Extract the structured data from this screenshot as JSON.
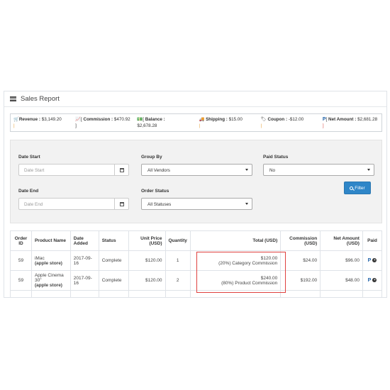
{
  "panel": {
    "title": "Sales Report",
    "title_icon": "list-icon"
  },
  "summary": {
    "revenue": {
      "icon": "cart-icon",
      "label": "Revenue :",
      "value": "$3,149.20",
      "after": "|"
    },
    "commission": {
      "icon": "chart-icon",
      "label": "Commission :",
      "value": "$470.92",
      "after": "]"
    },
    "balance": {
      "icon": "money-icon",
      "label": "Balance :",
      "value": "$2,678.28",
      "after": ""
    },
    "shipping": {
      "icon": "truck-icon",
      "label": "Shipping :",
      "value": "$15.00",
      "after": "|"
    },
    "coupon": {
      "icon": "tag-icon",
      "label": "Coupon :",
      "value": "-$12.00",
      "after": "|"
    },
    "net_amount": {
      "icon": "paypal-icon",
      "label": "Net Amount :",
      "value": "$2,681.28",
      "after": "]"
    }
  },
  "filters": {
    "date_start": {
      "label": "Date Start",
      "placeholder": "Date Start"
    },
    "date_end": {
      "label": "Date End",
      "placeholder": "Date End"
    },
    "group_by": {
      "label": "Group By",
      "value": "All Vendors"
    },
    "order_status": {
      "label": "Order Status",
      "value": "All Statuses"
    },
    "paid_status": {
      "label": "Paid Status",
      "value": "No"
    },
    "filter_button": "Filter"
  },
  "table": {
    "headers": {
      "order_id": "Order ID",
      "product_name": "Product Name",
      "date_added": "Date Added",
      "status": "Status",
      "unit_price": "Unit Price (USD)",
      "quantity": "Quantity",
      "total": "Total (USD)",
      "commission": "Commission (USD)",
      "net_amount": "Net Amount (USD)",
      "paid": "Paid"
    },
    "rows": [
      {
        "order_id": "59",
        "product": "iMac",
        "store": "(apple store)",
        "date": "2017-09-16",
        "status": "Complete",
        "unit_price": "$120.00",
        "quantity": "1",
        "total": "$120.00",
        "total_note": "(20%) Category Commission",
        "commission": "$24.00",
        "net": "$96.00"
      },
      {
        "order_id": "59",
        "product": "Apple Cinema 30\"",
        "store": "(apple store)",
        "date": "2017-09-16",
        "status": "Complete",
        "unit_price": "$120.00",
        "quantity": "2",
        "total": "$240.00",
        "total_note": "(80%) Product Commission",
        "commission": "$192.00",
        "net": "$48.00"
      }
    ]
  },
  "colors": {
    "filter_button": "#2f86c8",
    "highlight": "#e0413f",
    "paypal": "#1f62a8"
  }
}
